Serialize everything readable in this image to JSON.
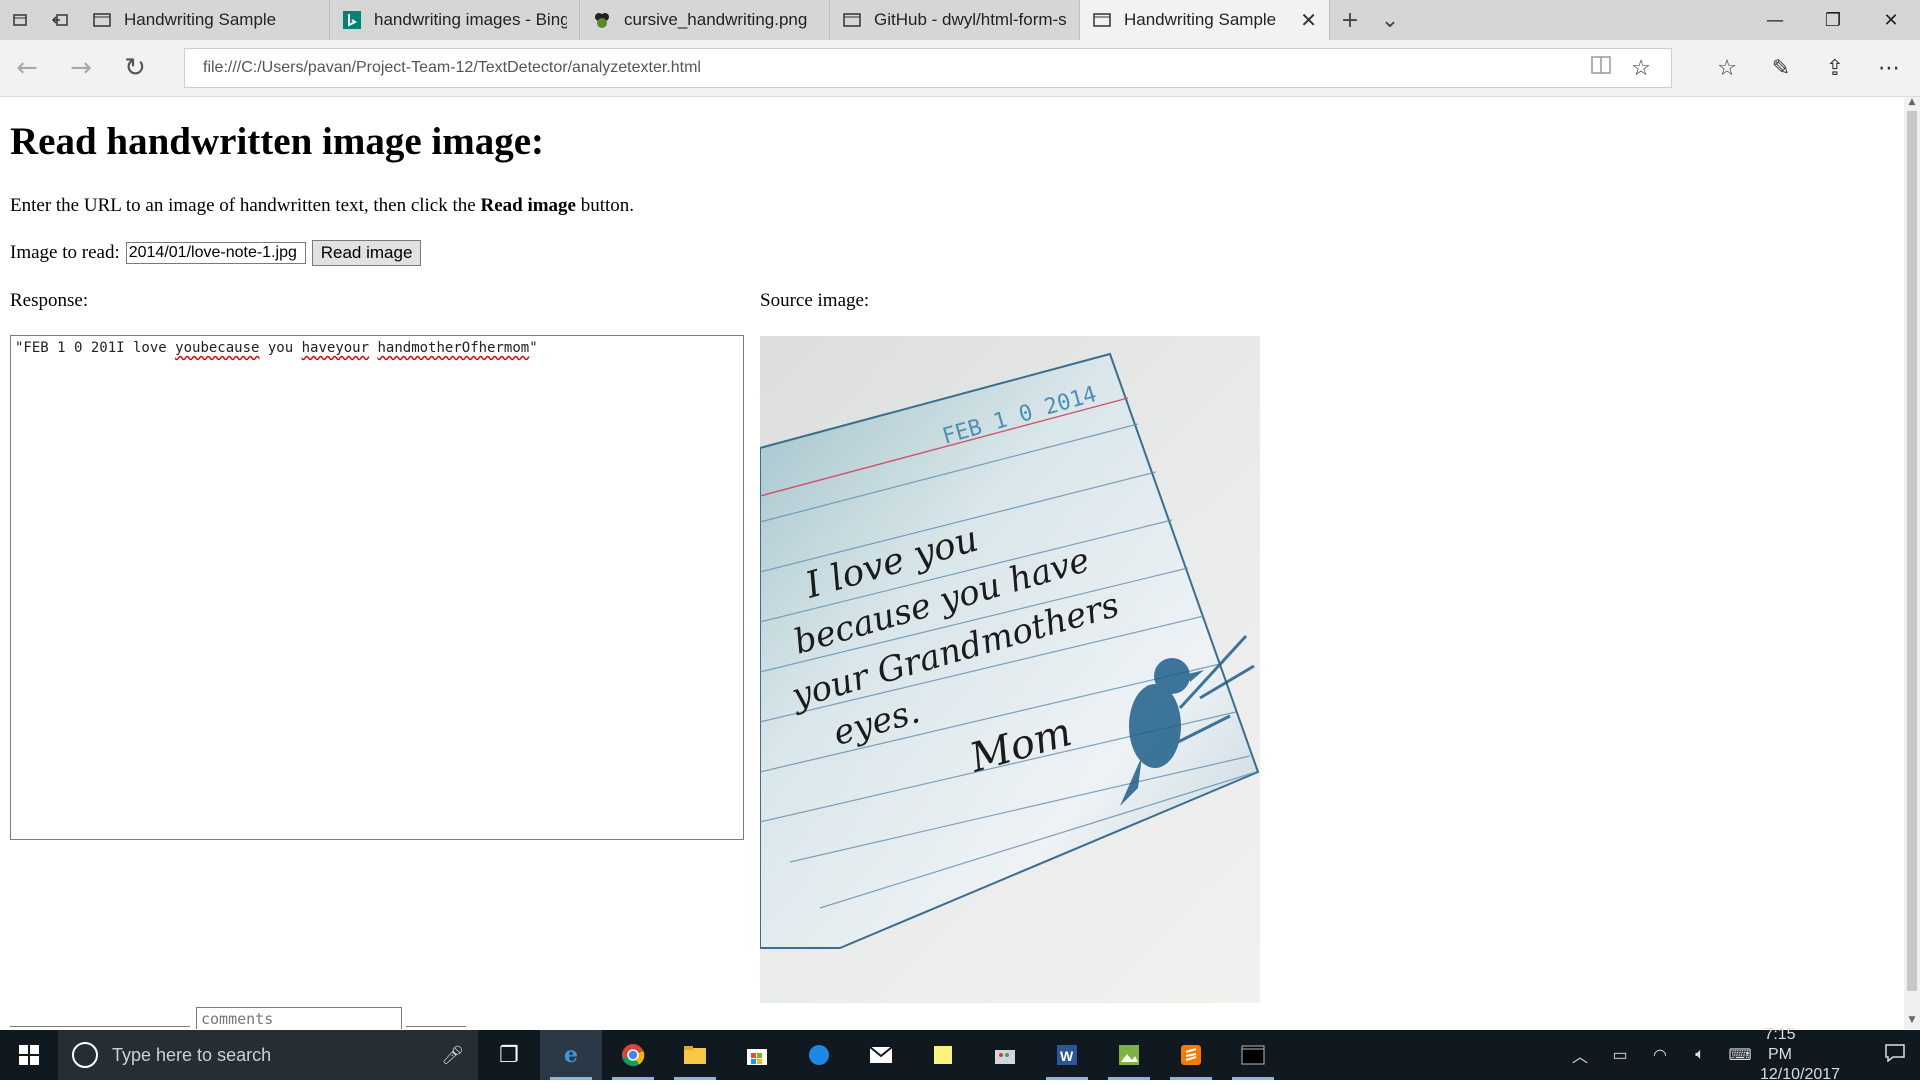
{
  "browser": {
    "tabs": [
      {
        "title": "Handwriting Sample",
        "favicon": "page-icon"
      },
      {
        "title": "handwriting images - Bing i",
        "favicon": "bing-icon"
      },
      {
        "title": "cursive_handwriting.png",
        "favicon": "image-icon"
      },
      {
        "title": "GitHub - dwyl/html-form-se",
        "favicon": "page-icon"
      },
      {
        "title": "Handwriting Sample",
        "favicon": "page-icon",
        "active": true
      }
    ],
    "address": "file:///C:/Users/pavan/Project-Team-12/TextDetector/analyzetexter.html"
  },
  "page": {
    "heading": "Read handwritten image image:",
    "intro_before": "Enter the URL to an image of handwritten text, then click the ",
    "intro_bold": "Read image",
    "intro_after": " button.",
    "image_label": "Image to read:",
    "image_url_value": "2014/01/love-note-1.jpg",
    "read_button": "Read image",
    "response_label": "Response:",
    "source_label": "Source image:",
    "response_parts": [
      "\"FEB 1 0 201I love ",
      "youbecause",
      " you ",
      "haveyour",
      " ",
      "handmotherOfhermom",
      "\""
    ],
    "comments_placeholder": "comments",
    "image_text": {
      "stamp": "FEB 1 0 2014",
      "line1": "I love you",
      "line2": "because you have",
      "line3": "your Grandmothers",
      "line4": "eyes.",
      "signature": "Mom"
    }
  },
  "taskbar": {
    "search_placeholder": "Type here to search",
    "time": "7:15 PM",
    "date": "12/10/2017"
  },
  "colors": {
    "tabbar": "#d6d6d6",
    "taskbar": "#101820",
    "spell_underline": "#e00000",
    "ink": "#1f5f8a"
  }
}
